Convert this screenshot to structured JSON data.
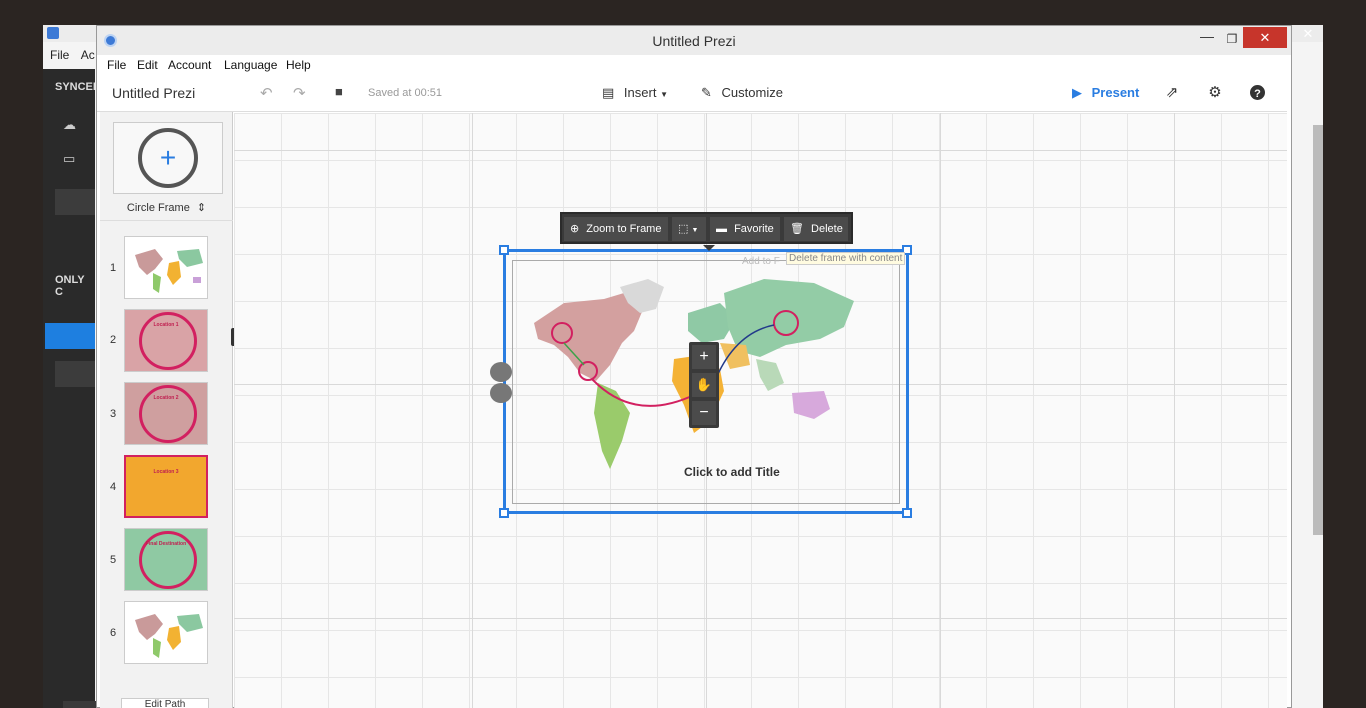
{
  "background_app": {
    "menu": [
      "File",
      "Ac"
    ],
    "sections": [
      "SYNCEI",
      "ONLY C"
    ],
    "close_glyph": "✕"
  },
  "window": {
    "title": "Untitled Prezi",
    "min_glyph": "—",
    "max_glyph": "❐",
    "close_glyph": "✕"
  },
  "menu": [
    "File",
    "Edit",
    "Account",
    "Language",
    "Help"
  ],
  "toolbar": {
    "doc_title": "Untitled Prezi",
    "saved_text": "Saved at 00:51",
    "insert_label": "Insert",
    "customize_label": "Customize",
    "present_label": "Present"
  },
  "panel": {
    "frame_type": "Circle Frame",
    "thumbs": [
      {
        "num": "1",
        "label": ""
      },
      {
        "num": "2",
        "label": "Location 1"
      },
      {
        "num": "3",
        "label": "Location 2"
      },
      {
        "num": "4",
        "label": "Location 3"
      },
      {
        "num": "5",
        "label": "Final Destination"
      },
      {
        "num": "6",
        "label": ""
      }
    ],
    "edit_path_label": "Edit Path"
  },
  "frame_toolbar": {
    "zoom_to_frame": "Zoom to Frame",
    "favorite": "Favorite",
    "delete": "Delete"
  },
  "tooltip": "Delete frame with content",
  "ghost_text": "Add to F",
  "canvas": {
    "click_to_add_title": "Click to add Title"
  },
  "colors": {
    "accent": "#2a7de1",
    "close_red": "#c7352b",
    "ring_pink": "#d22060"
  }
}
